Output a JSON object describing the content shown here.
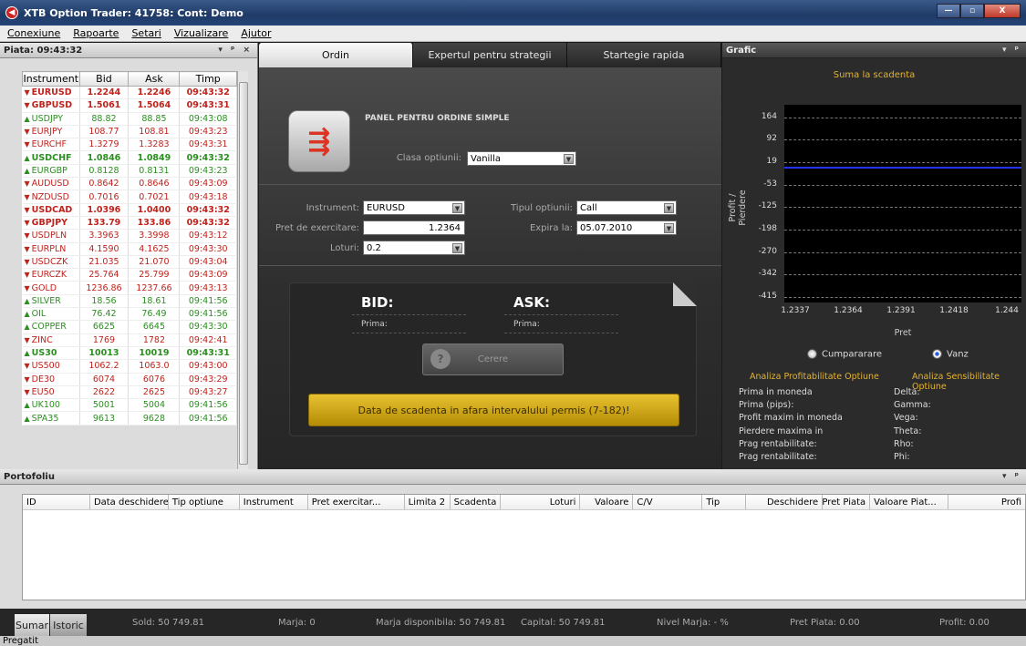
{
  "window": {
    "title": "XTB Option Trader: 41758: Cont: Demo",
    "minimize": "—",
    "maximize": "▫",
    "close": "X"
  },
  "menu": [
    "Conexiune",
    "Rapoarte",
    "Setari",
    "Vizualizare",
    "Ajutor"
  ],
  "market": {
    "title": "Piata: 09:43:32",
    "pins": "▾ ᵖ ×",
    "columns": [
      "Instrument",
      "Bid",
      "Ask",
      "Timp"
    ],
    "rows": [
      {
        "dir": "down",
        "bold": true,
        "name": "EURUSD",
        "bid": "1.2244",
        "ask": "1.2246",
        "time": "09:43:32"
      },
      {
        "dir": "down",
        "bold": true,
        "name": "GBPUSD",
        "bid": "1.5061",
        "ask": "1.5064",
        "time": "09:43:31"
      },
      {
        "dir": "up",
        "bold": false,
        "name": "USDJPY",
        "bid": "88.82",
        "ask": "88.85",
        "time": "09:43:08"
      },
      {
        "dir": "down",
        "bold": false,
        "name": "EURJPY",
        "bid": "108.77",
        "ask": "108.81",
        "time": "09:43:23"
      },
      {
        "dir": "down",
        "bold": false,
        "name": "EURCHF",
        "bid": "1.3279",
        "ask": "1.3283",
        "time": "09:43:31"
      },
      {
        "dir": "up",
        "bold": true,
        "name": "USDCHF",
        "bid": "1.0846",
        "ask": "1.0849",
        "time": "09:43:32"
      },
      {
        "dir": "up",
        "bold": false,
        "name": "EURGBP",
        "bid": "0.8128",
        "ask": "0.8131",
        "time": "09:43:23"
      },
      {
        "dir": "down",
        "bold": false,
        "name": "AUDUSD",
        "bid": "0.8642",
        "ask": "0.8646",
        "time": "09:43:09"
      },
      {
        "dir": "down",
        "bold": false,
        "name": "NZDUSD",
        "bid": "0.7016",
        "ask": "0.7021",
        "time": "09:43:18"
      },
      {
        "dir": "down",
        "bold": true,
        "name": "USDCAD",
        "bid": "1.0396",
        "ask": "1.0400",
        "time": "09:43:32"
      },
      {
        "dir": "down",
        "bold": true,
        "name": "GBPJPY",
        "bid": "133.79",
        "ask": "133.86",
        "time": "09:43:32"
      },
      {
        "dir": "down",
        "bold": false,
        "name": "USDPLN",
        "bid": "3.3963",
        "ask": "3.3998",
        "time": "09:43:12"
      },
      {
        "dir": "down",
        "bold": false,
        "name": "EURPLN",
        "bid": "4.1590",
        "ask": "4.1625",
        "time": "09:43:30"
      },
      {
        "dir": "down",
        "bold": false,
        "name": "USDCZK",
        "bid": "21.035",
        "ask": "21.070",
        "time": "09:43:04"
      },
      {
        "dir": "down",
        "bold": false,
        "name": "EURCZK",
        "bid": "25.764",
        "ask": "25.799",
        "time": "09:43:09"
      },
      {
        "dir": "down",
        "bold": false,
        "name": "GOLD",
        "bid": "1236.86",
        "ask": "1237.66",
        "time": "09:43:13"
      },
      {
        "dir": "up",
        "bold": false,
        "name": "SILVER",
        "bid": "18.56",
        "ask": "18.61",
        "time": "09:41:56"
      },
      {
        "dir": "up",
        "bold": false,
        "name": "OIL",
        "bid": "76.42",
        "ask": "76.49",
        "time": "09:41:56"
      },
      {
        "dir": "up",
        "bold": false,
        "name": "COPPER",
        "bid": "6625",
        "ask": "6645",
        "time": "09:43:30"
      },
      {
        "dir": "down",
        "bold": false,
        "name": "ZINC",
        "bid": "1769",
        "ask": "1782",
        "time": "09:42:41"
      },
      {
        "dir": "up",
        "bold": true,
        "name": "US30",
        "bid": "10013",
        "ask": "10019",
        "time": "09:43:31"
      },
      {
        "dir": "down",
        "bold": false,
        "name": "US500",
        "bid": "1062.2",
        "ask": "1063.0",
        "time": "09:43:00"
      },
      {
        "dir": "down",
        "bold": false,
        "name": "DE30",
        "bid": "6074",
        "ask": "6076",
        "time": "09:43:29"
      },
      {
        "dir": "down",
        "bold": false,
        "name": "EU50",
        "bid": "2622",
        "ask": "2625",
        "time": "09:43:27"
      },
      {
        "dir": "up",
        "bold": false,
        "name": "UK100",
        "bid": "5001",
        "ask": "5004",
        "time": "09:41:56"
      },
      {
        "dir": "up",
        "bold": false,
        "name": "SPA35",
        "bid": "9613",
        "ask": "9628",
        "time": "09:41:56"
      }
    ]
  },
  "order": {
    "tabs": [
      "Ordin",
      "Expertul pentru strategii",
      "Startegie rapida"
    ],
    "panel_title": "PANEL PENTRU ORDINE SIMPLE",
    "clasa_label": "Clasa optiunii:",
    "clasa_value": "Vanilla",
    "instrument_label": "Instrument:",
    "instrument_value": "EURUSD",
    "tip_label": "Tipul optiunii:",
    "tip_value": "Call",
    "pret_label": "Pret de exercitare:",
    "pret_value": "1.2364",
    "expira_label": "Expira la:",
    "expira_value": "05.07.2010",
    "loturi_label": "Loturi:",
    "loturi_value": "0.2",
    "bid_label": "BID:",
    "ask_label": "ASK:",
    "prima_bid": "Prima:",
    "prima_ask": "Prima:",
    "cerere": "Cerere",
    "warning": "Data de scadenta in afara intervalului permis (7-182)!"
  },
  "grafic": {
    "title": "Grafic",
    "pins": "▾ ᵖ",
    "radio_buy": "Cumpararare",
    "radio_sell": "Vanz",
    "analiza_profit_title": "Analiza Profitabilitate Optiune",
    "analiza_sens_title": "Analiza Sensibilitate Optiune",
    "profit_rows": [
      "Prima in moneda",
      "Prima (pips):",
      "Profit maxim in moneda",
      "Pierdere maxima in",
      "Prag rentabilitate:",
      "Prag rentabilitate:"
    ],
    "sens_rows": [
      "Delta:",
      "Gamma:",
      "Vega:",
      "Theta:",
      "Rho:",
      "Phi:"
    ]
  },
  "chart_data": {
    "type": "line",
    "title": "Suma la scadenta",
    "xlabel": "Pret",
    "ylabel": "Profit / Pierdere",
    "x_ticks": [
      "1.2337",
      "1.2364",
      "1.2391",
      "1.2418",
      "1.244"
    ],
    "y_ticks": [
      "164",
      "92",
      "19",
      "-53",
      "-125",
      "-198",
      "-270",
      "-342",
      "-415"
    ],
    "ylim": [
      -415,
      200
    ],
    "grid": true,
    "series": [
      {
        "x": [
          1.2325,
          1.2445
        ],
        "y": [
          5,
          5
        ],
        "color": "#2233ff"
      }
    ]
  },
  "portfolio": {
    "title": "Portofoliu",
    "pins": "▾ ᵖ",
    "columns": [
      "ID",
      "Data deschidere",
      "Tip optiune",
      "Instrument",
      "Pret exercitar...",
      "Limita 2",
      "Scadenta",
      "Loturi",
      "Valoare",
      "C/V",
      "Tip",
      "Deschidere",
      "Pret Piata",
      "Valoare Piat...",
      "Profi"
    ]
  },
  "bottom_tabs": [
    "Sumar",
    "Istoric"
  ],
  "status": {
    "sold": "Sold: 50 749.81",
    "marja": "Marja: 0",
    "marja_disp": "Marja disponibila: 50 749.81",
    "capital": "Capital: 50 749.81",
    "nivel": "Nivel Marja: - %",
    "pret_piata": "Pret Piata: 0.00",
    "profit": "Profit: 0.00"
  },
  "footer": "Pregatit"
}
